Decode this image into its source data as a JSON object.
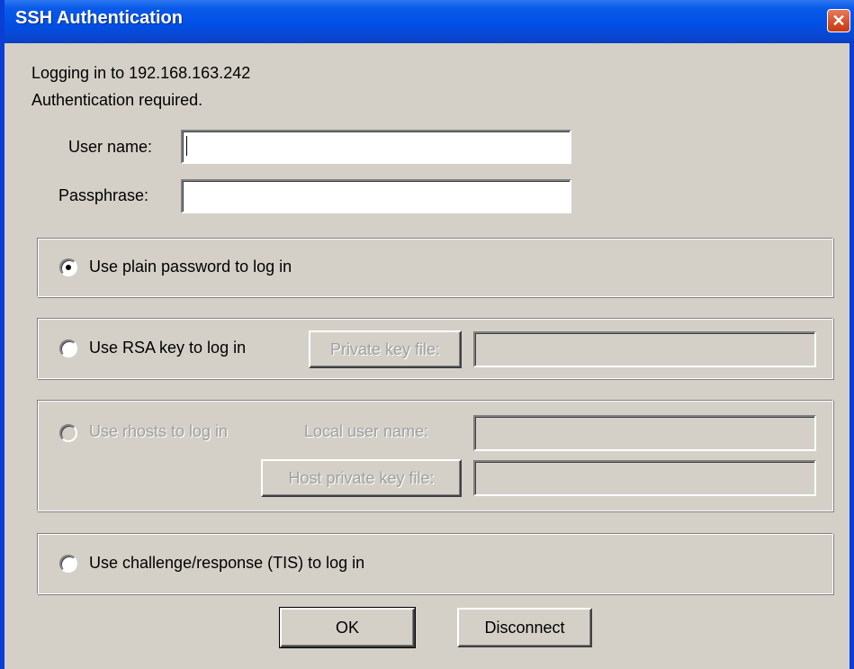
{
  "window": {
    "title": "SSH Authentication"
  },
  "message": {
    "line1": "Logging in to 192.168.163.242",
    "line2": "Authentication required."
  },
  "form": {
    "username_label": "User name:",
    "username_value": "",
    "passphrase_label": "Passphrase:",
    "passphrase_value": ""
  },
  "methods": {
    "plain": {
      "label": "Use plain password to log in",
      "selected": true
    },
    "rsa": {
      "label": "Use RSA key to log in",
      "keyfile_button": "Private key file:",
      "keyfile_value": ""
    },
    "rhosts": {
      "label": "Use rhosts to log in",
      "local_user_label": "Local user name:",
      "local_user_value": "",
      "host_key_button": "Host private key file:",
      "host_key_value": ""
    },
    "tis": {
      "label": "Use challenge/response (TIS) to log in"
    }
  },
  "buttons": {
    "ok": "OK",
    "disconnect": "Disconnect"
  },
  "icons": {
    "close": "close-icon"
  },
  "colors": {
    "titlebar": "#0050e6",
    "face": "#d4d0c8"
  }
}
